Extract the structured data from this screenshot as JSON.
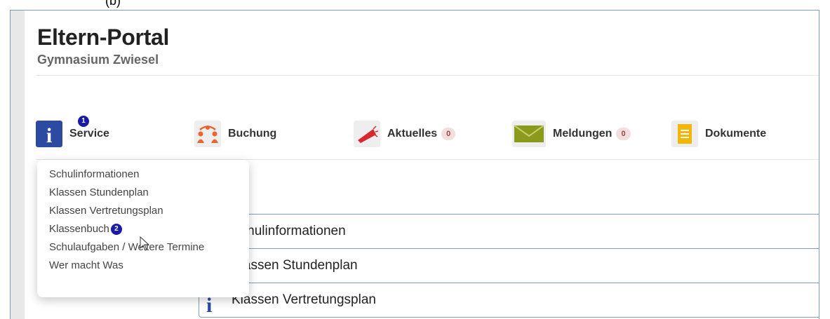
{
  "figure_label": "(b)",
  "header": {
    "title": "Eltern-Portal",
    "subtitle": "Gymnasium Zwiesel"
  },
  "nav": [
    {
      "label": "Service",
      "icon": "info-icon",
      "notification": "1"
    },
    {
      "label": "Buchung",
      "icon": "people-icon"
    },
    {
      "label": "Aktuelles",
      "icon": "megaphone-icon",
      "count": "0"
    },
    {
      "label": "Meldungen",
      "icon": "envelope-icon",
      "count": "0"
    },
    {
      "label": "Dokumente",
      "icon": "document-icon"
    }
  ],
  "dropdown": {
    "items": [
      {
        "label": "Schulinformationen"
      },
      {
        "label": "Klassen Stundenplan"
      },
      {
        "label": "Klassen Vertretungsplan"
      },
      {
        "label": "Klassenbuch",
        "badge": "2"
      },
      {
        "label": "Schulaufgaben / Weitere Termine"
      },
      {
        "label": "Wer macht Was"
      }
    ]
  },
  "accordion": {
    "items": [
      {
        "label": "Schulinformationen"
      },
      {
        "label": "Klassen Stundenplan"
      },
      {
        "label": "Klassen Vertretungsplan"
      }
    ]
  },
  "colors": {
    "service_icon": "#2c4aa0",
    "buchung_icon": "#e8662a",
    "aktuelles_icon": "#d9272e",
    "meldungen_icon": "#8a9a1b",
    "dokumente_icon": "#f2b705",
    "notification": "#1a1aaa",
    "count_badge_bg": "#f2dede"
  }
}
